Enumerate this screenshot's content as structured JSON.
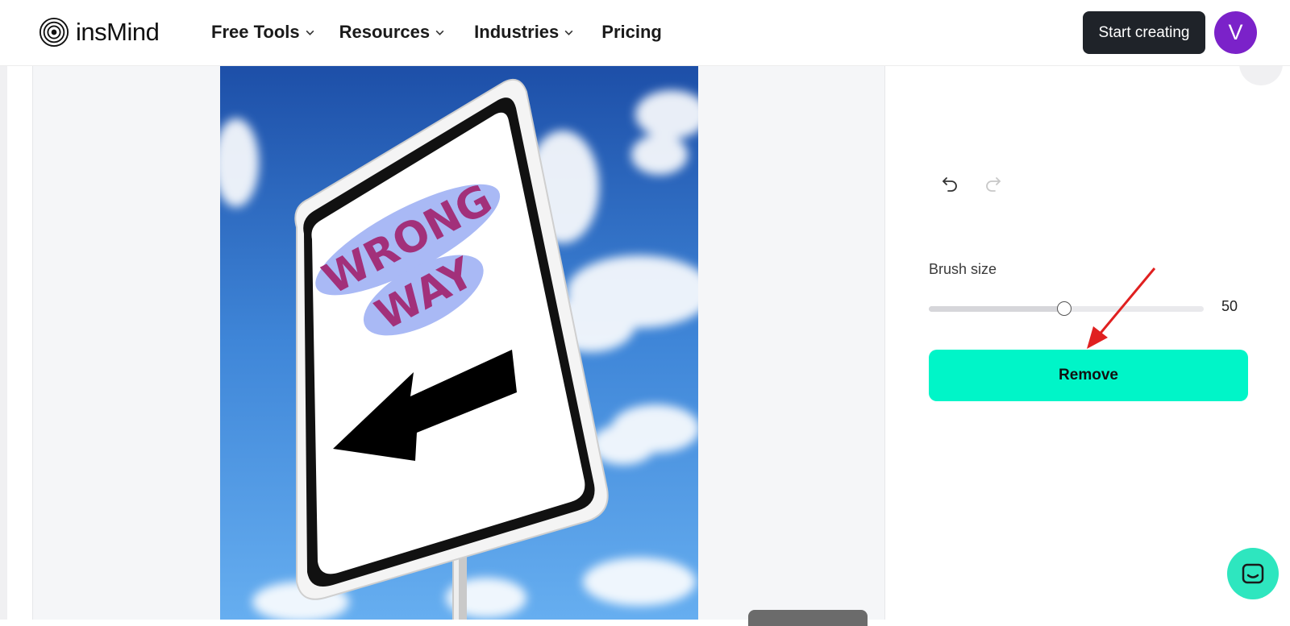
{
  "header": {
    "brand": "insMind",
    "nav": [
      {
        "label": "Free Tools",
        "has_dropdown": true
      },
      {
        "label": "Resources",
        "has_dropdown": true
      },
      {
        "label": "Industries",
        "has_dropdown": true
      },
      {
        "label": "Pricing",
        "has_dropdown": false
      }
    ],
    "cta_label": "Start creating",
    "avatar_initial": "V"
  },
  "canvas": {
    "image_description_text": [
      "WRONG",
      "WAY"
    ]
  },
  "panel": {
    "brush_label": "Brush size",
    "brush_value": "50",
    "brush_fraction": 0.5,
    "remove_label": "Remove"
  },
  "colors": {
    "accent": "#00f5c8",
    "dark": "#1f2329",
    "avatar": "#7b22c9",
    "annotation": "#e02020"
  },
  "icons": [
    "logo-icon",
    "chevron-down-icon",
    "undo-icon",
    "redo-icon",
    "close-icon",
    "chat-icon",
    "red-arrow-annotation"
  ]
}
